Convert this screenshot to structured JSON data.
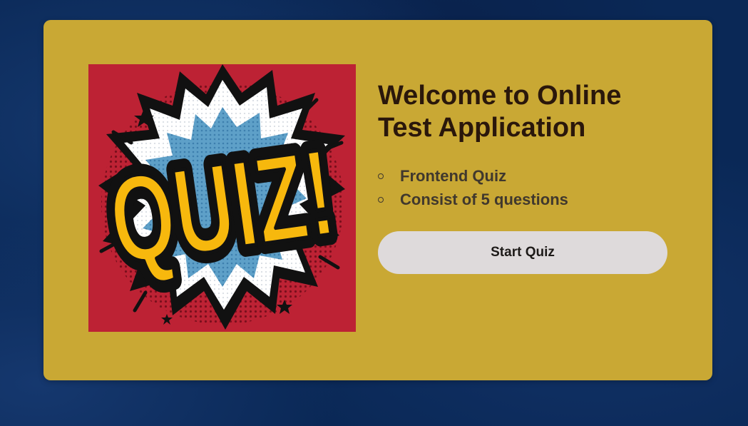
{
  "welcome": {
    "title": "Welcome to Online Test Application",
    "info_items": [
      {
        "label": "Frontend Quiz"
      },
      {
        "label": "Consist of 5 questions"
      }
    ],
    "start_button_label": "Start Quiz"
  },
  "quiz_image": {
    "lettering": "QUIZ!",
    "icon": "comic-burst-quiz-image"
  },
  "colors": {
    "page_background": "#0a2856",
    "card_background": "#c9a834",
    "image_background": "#bd2234",
    "title_text": "#2a170b",
    "list_text": "#40382d",
    "button_background": "#dedadb",
    "button_text": "#1d1a18",
    "lettering_fill": "#f7b80d"
  }
}
